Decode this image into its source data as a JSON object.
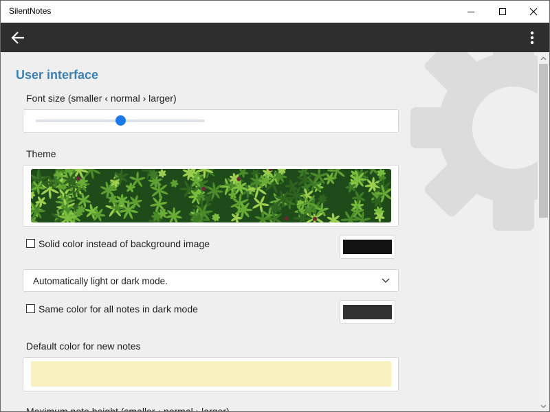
{
  "window": {
    "title": "SilentNotes",
    "controls": [
      "minimize-icon",
      "maximize-icon",
      "close-icon"
    ]
  },
  "appbar": {
    "back_icon": "arrow-left-icon",
    "menu_icon": "more-vertical-icon",
    "background": "#2e2e2e"
  },
  "settings": {
    "section_title": "User interface",
    "accent": "#3c7fb1",
    "font_size": {
      "label": "Font size (smaller ‹ normal › larger)",
      "value_fraction": 0.5,
      "thumb_color": "#1a78e8"
    },
    "theme": {
      "label": "Theme",
      "image": "green-leaves-background"
    },
    "solid_color": {
      "label": "Solid color instead of background image",
      "checked": false,
      "color": "#121212"
    },
    "mode_select": {
      "value": "Automatically light or dark mode."
    },
    "dark_notes": {
      "label": "Same color for all notes in dark mode",
      "checked": false,
      "color": "#323232"
    },
    "default_note_color": {
      "label": "Default color for new notes",
      "color": "#f9f1c0"
    },
    "max_note_height": {
      "label": "Maximum note height (smaller ‹ normal › larger)"
    }
  },
  "scrollbar": {
    "up_icon": "scroll-up-arrow-icon",
    "down_icon": "scroll-down-arrow-icon"
  }
}
